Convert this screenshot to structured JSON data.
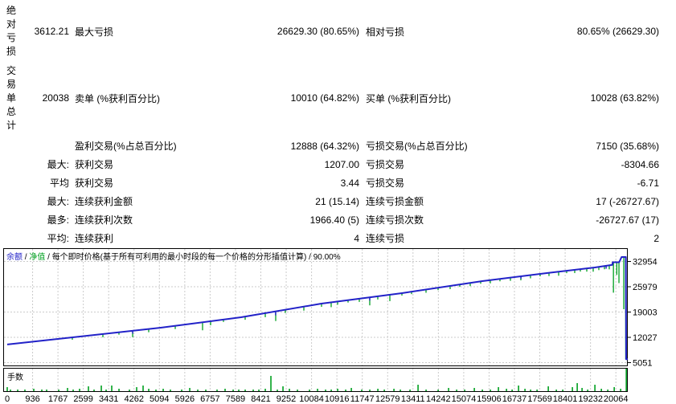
{
  "report": {
    "rows": [
      {
        "a": "绝对亏损",
        "b": "3612.21",
        "c": "最大亏损",
        "d": "26629.30 (80.65%)",
        "e": "相对亏损",
        "f": "80.65% (26629.30)"
      },
      {
        "a": "交易单总计",
        "b": "20038",
        "c": "卖单 (%获利百分比)",
        "d": "10010 (64.82%)",
        "e": "买单 (%获利百分比)",
        "f": "10028 (63.82%)"
      },
      {
        "a": "",
        "b": "",
        "c": "盈利交易(%占总百分比)",
        "d": "12888 (64.32%)",
        "e": "亏损交易(%占总百分比)",
        "f": "7150 (35.68%)"
      },
      {
        "a": "",
        "b": "最大:",
        "c": "获利交易",
        "d": "1207.00",
        "e": "亏损交易",
        "f": "-8304.66"
      },
      {
        "a": "",
        "b": "平均",
        "c": "获利交易",
        "d": "3.44",
        "e": "亏损交易",
        "f": "-6.71"
      },
      {
        "a": "",
        "b": "最大:",
        "c": "连续获利金额",
        "d": "21 (15.14)",
        "e": "连续亏损金额",
        "f": "17 (-26727.67)"
      },
      {
        "a": "",
        "b": "最多:",
        "c": "连续获利次数",
        "d": "1966.40 (5)",
        "e": "连续亏损次数",
        "f": "-26727.67 (17)"
      },
      {
        "a": "",
        "b": "平均:",
        "c": "连续获利",
        "d": "4",
        "e": "连续亏损",
        "f": "2"
      }
    ]
  },
  "graph": {
    "legend": {
      "balance_label": "余额",
      "equity_label": "净值",
      "sep": " / ",
      "description": "每个即时价格(基于所有可利用的最小时段的每一个价格的分形插值计算)",
      "quality": "90.00%"
    },
    "lots_label": "手数",
    "colors": {
      "balance": "#2222c8",
      "equity": "#00a020",
      "grid": "#cbcbcb",
      "border": "#000000",
      "background": "#ffffff"
    }
  },
  "chart_data": [
    {
      "type": "line",
      "title": "余额 / 净值 / 每个即时价格(基于所有可利用的最小时段的每一个价格的分形插值计算) / 90.00%",
      "legend_position": "top-left",
      "grid": true,
      "y_ticks": [
        32954,
        25979,
        19003,
        12027,
        5051
      ],
      "x_ticks": [
        0,
        936,
        1767,
        2599,
        3431,
        4262,
        5094,
        5926,
        6757,
        7589,
        8421,
        9252,
        10084,
        10916,
        11747,
        12579,
        13411,
        14242,
        15074,
        15906,
        16737,
        17569,
        18401,
        19232,
        20064
      ],
      "xlim": [
        0,
        20460
      ],
      "ylim": [
        5051,
        32954
      ],
      "series": [
        {
          "name": "余额",
          "color": "#2222c8",
          "points": [
            [
              0,
              9950
            ],
            [
              2400,
              12140
            ],
            [
              5060,
              14570
            ],
            [
              7710,
              17450
            ],
            [
              10360,
              21215
            ],
            [
              13015,
              24100
            ],
            [
              15665,
              27420
            ],
            [
              17790,
              29630
            ],
            [
              19380,
              31180
            ],
            [
              19955,
              31900
            ],
            [
              19965,
              32630
            ],
            [
              20180,
              32630
            ],
            [
              20260,
              34070
            ],
            [
              20400,
              34070
            ],
            [
              20410,
              5900
            ],
            [
              20460,
              5900
            ]
          ],
          "dip_notches": [
            [
              4135,
              800
            ],
            [
              8850,
              1100
            ],
            [
              11954,
              900
            ],
            [
              16940,
              700
            ],
            [
              19750,
              800
            ]
          ]
        },
        {
          "name": "净值",
          "color": "#00a020",
          "dips_below_balance": [
            [
              2147,
              660
            ],
            [
              3154,
              885
            ],
            [
              3684,
              660
            ],
            [
              4135,
              1770
            ],
            [
              4665,
              885
            ],
            [
              5540,
              885
            ],
            [
              6441,
              2215
            ],
            [
              6706,
              1110
            ],
            [
              7130,
              660
            ],
            [
              7846,
              885
            ],
            [
              8509,
              1110
            ],
            [
              8853,
              2660
            ],
            [
              9171,
              885
            ],
            [
              9781,
              1110
            ],
            [
              10364,
              885
            ],
            [
              10682,
              1330
            ],
            [
              10894,
              885
            ],
            [
              11239,
              660
            ],
            [
              11610,
              885
            ],
            [
              11954,
              2215
            ],
            [
              12219,
              885
            ],
            [
              12617,
              1770
            ],
            [
              13015,
              660
            ],
            [
              13333,
              660
            ],
            [
              13810,
              885
            ],
            [
              14208,
              660
            ],
            [
              14605,
              885
            ],
            [
              14923,
              660
            ],
            [
              15268,
              885
            ],
            [
              15612,
              660
            ],
            [
              15930,
              885
            ],
            [
              16248,
              660
            ],
            [
              16593,
              885
            ],
            [
              16937,
              1110
            ],
            [
              17255,
              885
            ],
            [
              17573,
              660
            ],
            [
              17865,
              885
            ],
            [
              18183,
              1110
            ],
            [
              18448,
              660
            ],
            [
              18713,
              885
            ],
            [
              18899,
              660
            ],
            [
              19111,
              885
            ],
            [
              19323,
              1110
            ],
            [
              19509,
              885
            ],
            [
              19694,
              885
            ],
            [
              19853,
              1110
            ],
            [
              19990,
              8400
            ],
            [
              20100,
              3500
            ],
            [
              20172,
              5760
            ],
            [
              20331,
              14400
            ],
            [
              20395,
              28200
            ]
          ]
        }
      ]
    },
    {
      "type": "bar",
      "title": "手数",
      "note": "no y-axis scale shown; heights are pixel heights",
      "bars": [
        [
          0,
          5
        ],
        [
          106,
          2
        ],
        [
          345,
          2
        ],
        [
          583,
          2
        ],
        [
          875,
          3
        ],
        [
          1140,
          2
        ],
        [
          1299,
          2
        ],
        [
          1697,
          2
        ],
        [
          1988,
          4
        ],
        [
          2174,
          2
        ],
        [
          2386,
          3
        ],
        [
          2678,
          6
        ],
        [
          2863,
          2
        ],
        [
          3102,
          7
        ],
        [
          3261,
          2
        ],
        [
          3446,
          7
        ],
        [
          3685,
          3
        ],
        [
          4029,
          2
        ],
        [
          4268,
          5
        ],
        [
          4480,
          7
        ],
        [
          4666,
          3
        ],
        [
          4904,
          2
        ],
        [
          5143,
          3
        ],
        [
          5381,
          2
        ],
        [
          5753,
          2
        ],
        [
          6018,
          4
        ],
        [
          6283,
          2
        ],
        [
          6548,
          2
        ],
        [
          6919,
          2
        ],
        [
          7184,
          3
        ],
        [
          7450,
          2
        ],
        [
          7635,
          2
        ],
        [
          7847,
          2
        ],
        [
          8112,
          2
        ],
        [
          8298,
          2
        ],
        [
          8510,
          3
        ],
        [
          8695,
          19
        ],
        [
          8907,
          2
        ],
        [
          9093,
          6
        ],
        [
          9305,
          3
        ],
        [
          9570,
          2
        ],
        [
          9968,
          2
        ],
        [
          10233,
          3
        ],
        [
          10498,
          2
        ],
        [
          10684,
          2
        ],
        [
          10896,
          3
        ],
        [
          11161,
          2
        ],
        [
          11347,
          4
        ],
        [
          11691,
          2
        ],
        [
          11956,
          2
        ],
        [
          12222,
          3
        ],
        [
          12434,
          2
        ],
        [
          12752,
          3
        ],
        [
          12964,
          2
        ],
        [
          13282,
          2
        ],
        [
          13547,
          8
        ],
        [
          13812,
          2
        ],
        [
          14210,
          2
        ],
        [
          14554,
          4
        ],
        [
          14820,
          2
        ],
        [
          15085,
          2
        ],
        [
          15403,
          4
        ],
        [
          15668,
          2
        ],
        [
          15933,
          2
        ],
        [
          16198,
          5
        ],
        [
          16463,
          3
        ],
        [
          16649,
          2
        ],
        [
          16861,
          7
        ],
        [
          17073,
          3
        ],
        [
          17259,
          2
        ],
        [
          17471,
          2
        ],
        [
          17842,
          6
        ],
        [
          18107,
          2
        ],
        [
          18319,
          2
        ],
        [
          18637,
          5
        ],
        [
          18796,
          10
        ],
        [
          18955,
          4
        ],
        [
          19141,
          2
        ],
        [
          19379,
          8
        ],
        [
          19592,
          3
        ],
        [
          19804,
          2
        ],
        [
          20016,
          5
        ],
        [
          20228,
          3
        ],
        [
          20414,
          28
        ]
      ]
    }
  ]
}
